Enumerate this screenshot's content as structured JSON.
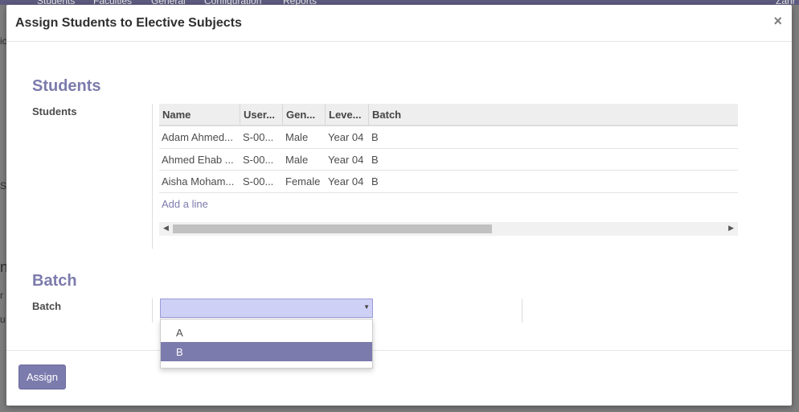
{
  "background": {
    "nav_items": [
      "Students",
      "Faculties",
      "General",
      "Configuration",
      "Reports"
    ],
    "user_fragment": "Zahr",
    "left_fragments": [
      "ic",
      "Su",
      "n",
      "r",
      "u"
    ]
  },
  "modal": {
    "title": "Assign Students to Elective Subjects",
    "close_glyph": "×",
    "students_section": {
      "heading": "Students",
      "field_label": "Students",
      "columns": [
        "Name",
        "User...",
        "Gen...",
        "Leve...",
        "Batch"
      ],
      "rows": [
        [
          "Adam Ahmed...",
          "S-00...",
          "Male",
          "Year 04",
          "B"
        ],
        [
          "Ahmed Ehab ...",
          "S-00...",
          "Male",
          "Year 04",
          "B"
        ],
        [
          "Aisha Moham...",
          "S-00...",
          "Female",
          "Year 04",
          "B"
        ]
      ],
      "add_line": "Add a line"
    },
    "batch_section": {
      "heading": "Batch",
      "field_label": "Batch",
      "selected_value": "",
      "options": [
        "A",
        "B"
      ],
      "highlighted_option": "B"
    },
    "footer": {
      "assign_button": "Assign"
    }
  },
  "colors": {
    "accent": "#7c7bad",
    "select_bg": "#cfd0f5",
    "navbar": "#5e5b80"
  }
}
